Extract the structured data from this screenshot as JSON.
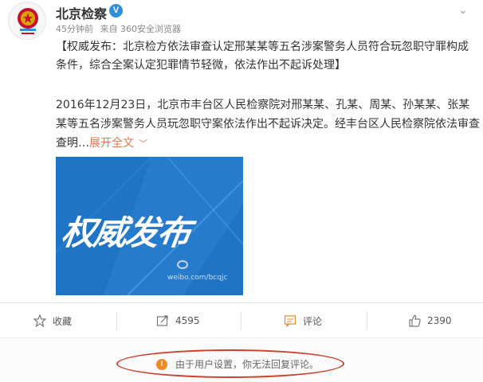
{
  "post": {
    "author": "北京检察",
    "verified_badge": "V",
    "time": "45分钟前",
    "source": "来自 360安全浏览器",
    "more_glyph": "⌄",
    "lead_text": "【权威发布：北京检方依法审查认定邢某某等五名涉案警务人员符合玩忽职守罪构成条件，综合全案认定犯罪情节轻微，依法作出不起诉处理】",
    "body_text": "2016年12月23日，北京市丰台区人民检察院对邢某某、孔某、周某、孙某某、张某某等五名涉案警务人员玩忽职守案依法作出不起诉决定。经丰台区人民检察院依法审查查明…",
    "expand_label": "展开全文",
    "expand_icon": "chevron-down",
    "image": {
      "title": "权威发布",
      "watermark": "weibo.com/bcqjc",
      "bg_color": "#1f74c6"
    }
  },
  "actions": [
    {
      "key": "favorite",
      "label": "收藏",
      "icon": "star"
    },
    {
      "key": "repost",
      "label": "4595",
      "icon": "repost"
    },
    {
      "key": "comment",
      "label": "评论",
      "icon": "comment"
    },
    {
      "key": "like",
      "label": "2390",
      "icon": "thumbs-up"
    }
  ],
  "notice": {
    "icon_glyph": "!",
    "text": "由于用户设置，你无法回复评论。",
    "highlight_color": "#c9412f"
  },
  "colors": {
    "link": "#eb7350",
    "verified": "#2e8fd8",
    "warning": "#f08a24"
  }
}
